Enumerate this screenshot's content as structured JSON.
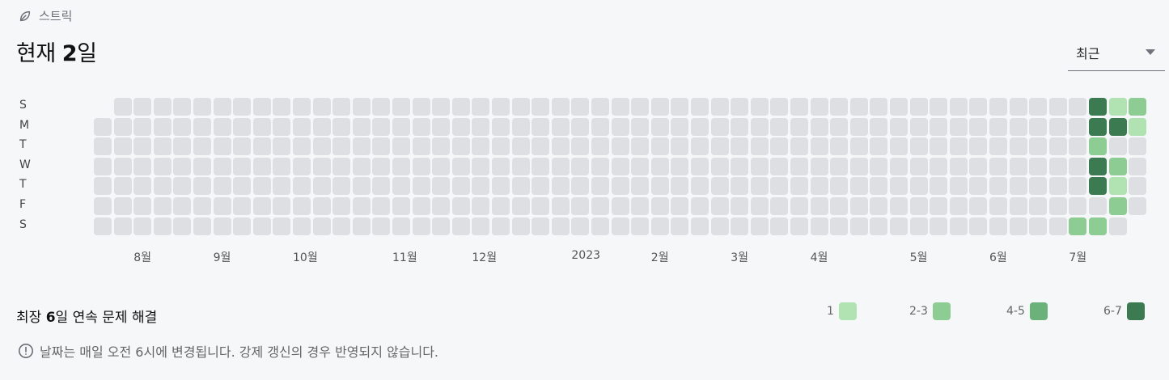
{
  "header": {
    "label": "스트릭",
    "icon": "leaf-icon",
    "title_prefix": "현재 ",
    "title_value": "2",
    "title_suffix": "일"
  },
  "dropdown": {
    "selected": "최근"
  },
  "day_labels": [
    "S",
    "M",
    "T",
    "W",
    "T",
    "F",
    "S"
  ],
  "month_labels": [
    {
      "label": "8월",
      "col": 2
    },
    {
      "label": "9월",
      "col": 6
    },
    {
      "label": "10월",
      "col": 10
    },
    {
      "label": "11월",
      "col": 15
    },
    {
      "label": "12월",
      "col": 19
    },
    {
      "label": "2023",
      "col": 24
    },
    {
      "label": "2월",
      "col": 28
    },
    {
      "label": "3월",
      "col": 32
    },
    {
      "label": "4월",
      "col": 36
    },
    {
      "label": "5월",
      "col": 41
    },
    {
      "label": "6월",
      "col": 45
    },
    {
      "label": "7월",
      "col": 49
    }
  ],
  "grid": {
    "weeks": 53,
    "first_week_start_row": 1,
    "last_week_end_row": 5,
    "colors": [
      "#dddfe2",
      "#b0e2b2",
      "#8dcc93",
      "#6ab17a",
      "#3c7a52"
    ],
    "filled": [
      {
        "col": 49,
        "row": 6,
        "level": 2
      },
      {
        "col": 50,
        "row": 0,
        "level": 4
      },
      {
        "col": 50,
        "row": 1,
        "level": 4
      },
      {
        "col": 50,
        "row": 2,
        "level": 2
      },
      {
        "col": 50,
        "row": 3,
        "level": 4
      },
      {
        "col": 50,
        "row": 4,
        "level": 4
      },
      {
        "col": 50,
        "row": 6,
        "level": 2
      },
      {
        "col": 51,
        "row": 0,
        "level": 1
      },
      {
        "col": 51,
        "row": 1,
        "level": 4
      },
      {
        "col": 51,
        "row": 3,
        "level": 2
      },
      {
        "col": 51,
        "row": 4,
        "level": 1
      },
      {
        "col": 51,
        "row": 5,
        "level": 2
      },
      {
        "col": 52,
        "row": 0,
        "level": 2
      },
      {
        "col": 52,
        "row": 1,
        "level": 1
      }
    ]
  },
  "streak": {
    "prefix": "최장 ",
    "value": "6",
    "suffix": "일 연속 문제 해결"
  },
  "legend": [
    {
      "label": "1",
      "color": "#b0e2b2"
    },
    {
      "label": "2-3",
      "color": "#8dcc93"
    },
    {
      "label": "4-5",
      "color": "#6ab17a"
    },
    {
      "label": "6-7",
      "color": "#3c7a52"
    }
  ],
  "note": {
    "icon": "info-circle-icon",
    "text": "날짜는 매일 오전 6시에 변경됩니다. 강제 갱신의 경우 반영되지 않습니다."
  }
}
